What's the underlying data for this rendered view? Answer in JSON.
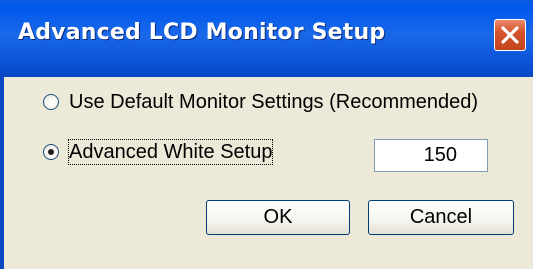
{
  "window": {
    "title": "Advanced LCD Monitor Setup",
    "close_icon": "close-icon"
  },
  "options": [
    {
      "label": "Use Default Monitor Settings (Recommended)",
      "selected": false
    },
    {
      "label": "Advanced White Setup",
      "selected": true
    }
  ],
  "white_value": "150",
  "buttons": {
    "ok_label": "OK",
    "cancel_label": "Cancel"
  },
  "colors": {
    "title_bar": "#0a54e0",
    "close_button": "#d6542c",
    "dialog_background": "#ece9d8"
  }
}
